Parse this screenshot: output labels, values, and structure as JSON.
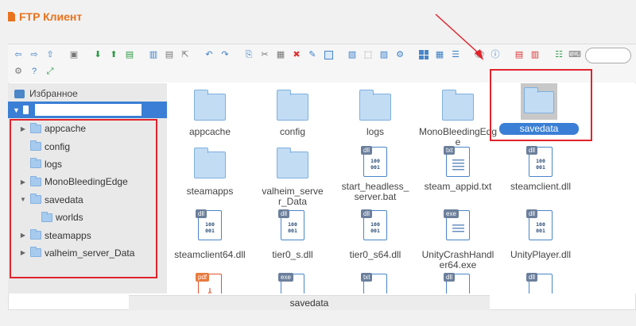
{
  "app": {
    "title": "FTP Клиент"
  },
  "sidebar": {
    "favorites_label": "Избранное",
    "items": [
      {
        "label": "appcache",
        "expandable": true
      },
      {
        "label": "config",
        "expandable": false
      },
      {
        "label": "logs",
        "expandable": false
      },
      {
        "label": "MonoBleedingEdge",
        "expandable": true
      },
      {
        "label": "savedata",
        "expandable": true,
        "expanded": true
      },
      {
        "label": "worlds",
        "expandable": false,
        "child": true
      },
      {
        "label": "steamapps",
        "expandable": true
      },
      {
        "label": "valheim_server_Data",
        "expandable": true
      }
    ]
  },
  "files": {
    "row1": [
      {
        "label": "appcache",
        "type": "folder"
      },
      {
        "label": "config",
        "type": "folder"
      },
      {
        "label": "logs",
        "type": "folder"
      },
      {
        "label": "MonoBleedingEdge",
        "type": "folder"
      },
      {
        "label": "savedata",
        "type": "folder",
        "selected": true
      }
    ],
    "row2": [
      {
        "label": "steamapps",
        "type": "folder"
      },
      {
        "label": "valheim_server_Data",
        "type": "folder"
      },
      {
        "label": "start_headless_server.bat",
        "type": "dll",
        "badge": "dll"
      },
      {
        "label": "steam_appid.txt",
        "type": "txt",
        "badge": "txt"
      },
      {
        "label": "steamclient.dll",
        "type": "dll",
        "badge": "dll"
      }
    ],
    "row3": [
      {
        "label": "steamclient64.dll",
        "badge": "dll"
      },
      {
        "label": "tier0_s.dll",
        "badge": "dll"
      },
      {
        "label": "tier0_s64.dll",
        "badge": "dll"
      },
      {
        "label": "UnityCrashHandler64.exe",
        "badge": "exe"
      },
      {
        "label": "UnityPlayer.dll",
        "badge": "dll"
      }
    ],
    "row4": [
      {
        "badge": "pdf"
      },
      {
        "badge": "exe"
      },
      {
        "badge": "txt"
      },
      {
        "badge": "dll"
      },
      {
        "badge": "dll"
      }
    ],
    "binary_text": "100\n001"
  },
  "status": {
    "selected": "savedata"
  },
  "colors": {
    "accent": "#3a7fd5",
    "title": "#e8731e",
    "highlight": "#e0242c"
  }
}
